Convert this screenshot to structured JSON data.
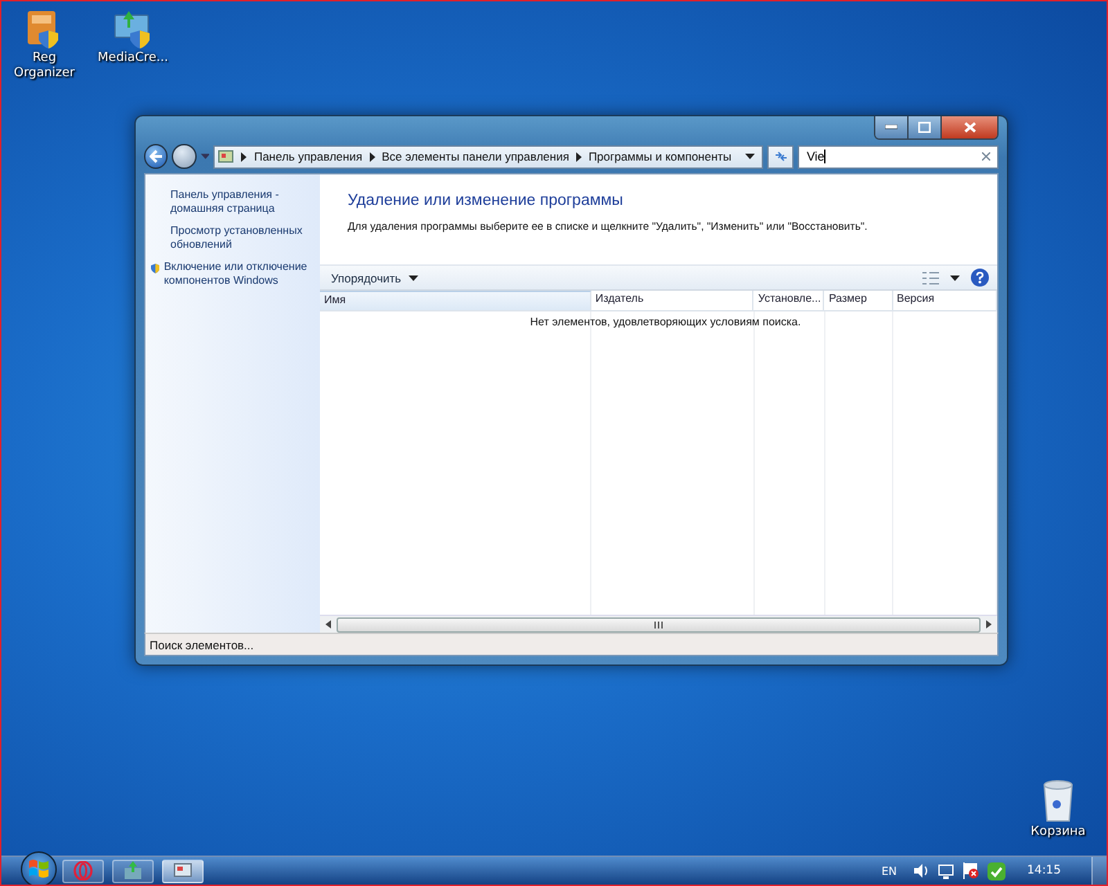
{
  "desktop_icons": [
    {
      "label": "Reg Organizer",
      "kind": "app"
    },
    {
      "label": "MediaCre...",
      "kind": "installer"
    },
    {
      "label": "Корзина",
      "kind": "trash"
    }
  ],
  "window": {
    "breadcrumb": [
      "Панель управления",
      "Все элементы панели управления",
      "Программы и компоненты"
    ],
    "search": {
      "value": "Vie"
    },
    "sidebar": {
      "items": [
        {
          "label": "Панель управления - домашняя страница",
          "kind": "link"
        },
        {
          "label": "Просмотр установленных обновлений",
          "kind": "link"
        },
        {
          "label": "Включение или отключение компонентов Windows",
          "kind": "admin-link"
        }
      ]
    },
    "title": "Удаление или изменение программы",
    "description": "Для удаления программы выберите ее в списке и щелкните \"Удалить\", \"Изменить\" или \"Восстановить\".",
    "toolbar": {
      "organize": "Упорядочить"
    },
    "table": {
      "columns": [
        {
          "label": "Имя",
          "sorted": true
        },
        {
          "label": "Издатель",
          "sorted": false
        },
        {
          "label": "Установле...",
          "sorted": false
        },
        {
          "label": "Размер",
          "sorted": false
        },
        {
          "label": "Версия",
          "sorted": false
        }
      ],
      "empty_message": "Нет элементов, удовлетворяющих условиям поиска."
    },
    "status_bar": "Поиск элементов..."
  },
  "taskbar": {
    "buttons": [
      {
        "kind": "opera",
        "selected": false
      },
      {
        "kind": "installer",
        "selected": false
      },
      {
        "kind": "control-panel",
        "selected": true
      }
    ],
    "language": "EN",
    "clock": "14:15"
  }
}
